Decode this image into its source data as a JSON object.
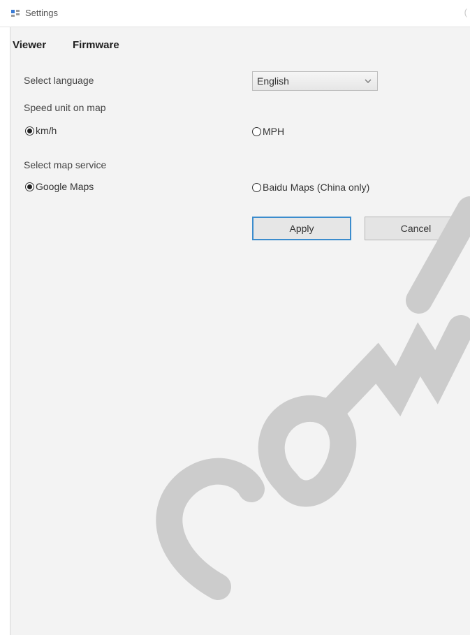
{
  "window": {
    "title": "Settings",
    "title_icon": "settings-app-icon",
    "edge_mark": "("
  },
  "tabs": [
    {
      "label": "Viewer",
      "active": true
    },
    {
      "label": "Firmware",
      "active": false
    }
  ],
  "language": {
    "label": "Select language",
    "selected": "English",
    "arrow_icon": "chevron-down-icon"
  },
  "speed_unit": {
    "label": "Speed unit on map",
    "options": [
      {
        "label": "km/h",
        "checked": true
      },
      {
        "label": "MPH",
        "checked": false
      }
    ]
  },
  "map_service": {
    "label": "Select map service",
    "options": [
      {
        "label": "Google Maps",
        "checked": true
      },
      {
        "label": "Baidu Maps (China only)",
        "checked": false
      }
    ]
  },
  "buttons": {
    "apply": "Apply",
    "cancel": "Cancel"
  },
  "colors": {
    "focus_border": "#3b8ccd",
    "window_bg": "#f3f3f3",
    "watermark": "#cccccc"
  }
}
